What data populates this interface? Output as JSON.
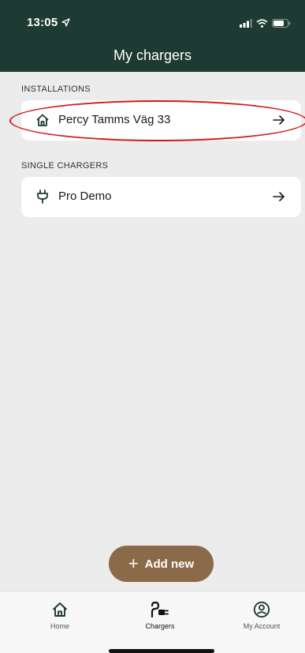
{
  "status_bar": {
    "time": "13:05"
  },
  "header": {
    "title": "My chargers"
  },
  "installations": {
    "label": "INSTALLATIONS",
    "items": [
      {
        "name": "Percy Tamms Väg 33",
        "icon": "home-icon"
      }
    ]
  },
  "single_chargers": {
    "label": "SINGLE CHARGERS",
    "items": [
      {
        "name": "Pro Demo",
        "icon": "plug-icon"
      }
    ]
  },
  "add_button": {
    "label": "Add new"
  },
  "tabs": [
    {
      "label": "Home",
      "icon": "home-icon",
      "active": false
    },
    {
      "label": "Chargers",
      "icon": "charger-icon",
      "active": true
    },
    {
      "label": "My Account",
      "icon": "account-icon",
      "active": false
    }
  ],
  "colors": {
    "header": "#1d3b32",
    "accent": "#8b6a4a",
    "background": "#ececec",
    "highlight": "#d11a1a"
  }
}
